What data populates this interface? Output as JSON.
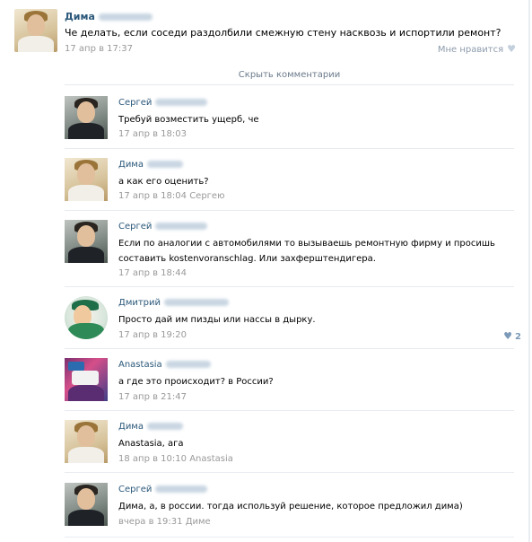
{
  "post": {
    "author": "Дима",
    "text": "Че делать, если соседи раздолбили смежную стену насквозь и испортили ремонт?",
    "date": "17 апр в 17:37",
    "like_label": "Мне нравится",
    "like_icon": "heart-icon"
  },
  "hide_comments_label": "Скрыть комментарии",
  "comments": [
    {
      "author": "Сергей",
      "text": "Требуй возместить ущерб, че",
      "date": "17 апр в 18:03",
      "reply_to": ""
    },
    {
      "author": "Дима",
      "text": "а как его оценить?",
      "date": "17 апр в 18:04",
      "reply_to": "Сергею"
    },
    {
      "author": "Сергей",
      "text": "Если по аналогии с автомобилями то вызываешь ремонтную фирму и просишь составить kostenvoranschlag. Или захферштендигера.",
      "date": "17 апр в 18:44",
      "reply_to": ""
    },
    {
      "author": "Дмитрий",
      "text": "Просто дай им пизды или нассы в дырку.",
      "date": "17 апр в 19:20",
      "reply_to": "",
      "likes": "2"
    },
    {
      "author": "Anastasia",
      "text": "а где это происходит? в России?",
      "date": "17 апр в 21:47",
      "reply_to": ""
    },
    {
      "author": "Дима",
      "text": "Anastasia, ага",
      "date": "18 апр в 10:10",
      "reply_to": "Anastasia"
    },
    {
      "author": "Сергей",
      "text": "Дима, а, в россии. тогда используй решение, которое предложил дима)",
      "date": "вчера в 19:31",
      "reply_to": "Диме"
    }
  ],
  "colors": {
    "link": "#2b587a",
    "meta": "#999999",
    "divider": "#e8ebef"
  }
}
